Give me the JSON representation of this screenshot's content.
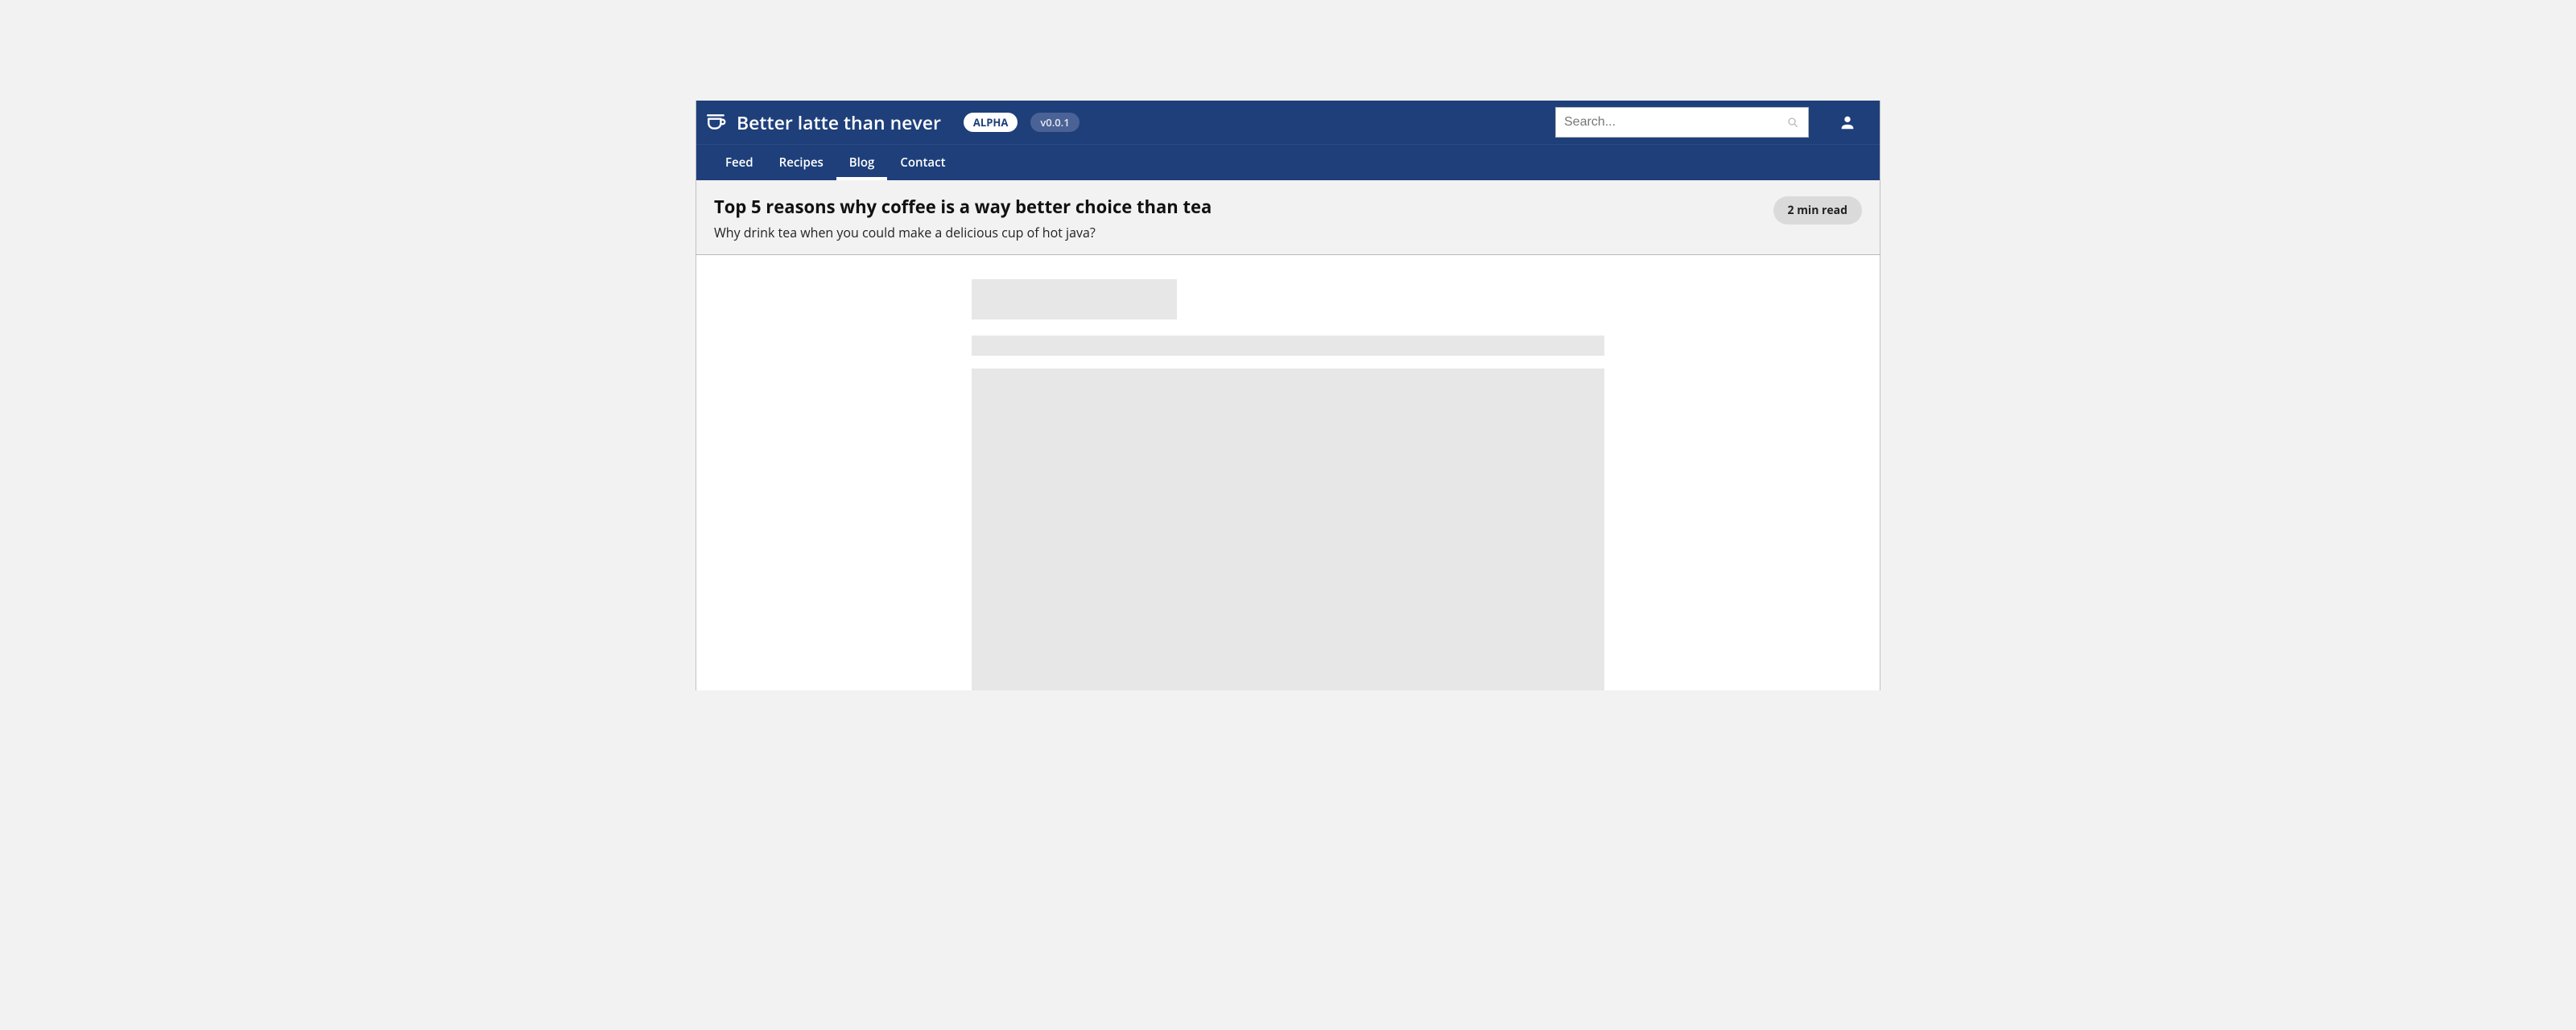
{
  "header": {
    "app_title": "Better latte than never",
    "alpha_label": "ALPHA",
    "version_label": "v0.0.1",
    "search_placeholder": "Search..."
  },
  "nav": {
    "items": [
      {
        "label": "Feed",
        "active": false
      },
      {
        "label": "Recipes",
        "active": false
      },
      {
        "label": "Blog",
        "active": true
      },
      {
        "label": "Contact",
        "active": false
      }
    ]
  },
  "article": {
    "title": "Top 5 reasons why coffee is a way better choice than tea",
    "subtitle": "Why drink tea when you could make a delicious cup of hot java?",
    "read_time": "2 min read"
  }
}
